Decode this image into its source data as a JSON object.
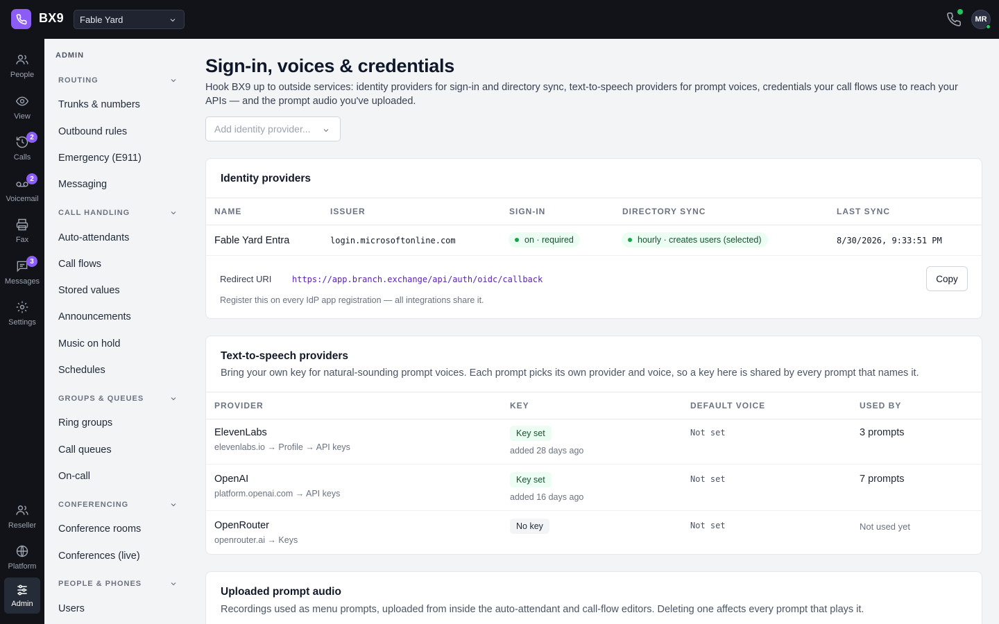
{
  "brand": {
    "name": "BX9",
    "org": "Fable Yard"
  },
  "user": {
    "initials": "MR"
  },
  "rail": {
    "people": "People",
    "view": "View",
    "calls": "Calls",
    "calls_badge": "2",
    "voicemail": "Voicemail",
    "voicemail_badge": "2",
    "fax": "Fax",
    "messages": "Messages",
    "messages_badge": "3",
    "settings": "Settings",
    "reseller": "Reseller",
    "platform": "Platform",
    "admin": "Admin"
  },
  "subnav": {
    "title": "ADMIN",
    "groups": {
      "routing": "ROUTING",
      "call_handling": "CALL HANDLING",
      "groups_queues": "GROUPS & QUEUES",
      "conferencing": "CONFERENCING",
      "people_phones": "PEOPLE & PHONES"
    },
    "links": {
      "trunks": "Trunks & numbers",
      "outbound": "Outbound rules",
      "emergency": "Emergency (E911)",
      "messaging": "Messaging",
      "auto_attendants": "Auto-attendants",
      "call_flows": "Call flows",
      "stored_values": "Stored values",
      "announcements": "Announcements",
      "moh": "Music on hold",
      "schedules": "Schedules",
      "ring_groups": "Ring groups",
      "call_queues": "Call queues",
      "on_call": "On-call",
      "conference_rooms": "Conference rooms",
      "conferences_live": "Conferences (live)",
      "users": "Users"
    }
  },
  "page": {
    "title": "Sign-in, voices & credentials",
    "description": "Hook BX9 up to outside services: identity providers for sign-in and directory sync, text-to-speech providers for prompt voices, credentials your call flows use to reach your APIs — and the prompt audio you've uploaded.",
    "add_idp_placeholder": "Add identity provider..."
  },
  "idp": {
    "title": "Identity providers",
    "headers": {
      "name": "NAME",
      "issuer": "ISSUER",
      "signin": "SIGN-IN",
      "dirsync": "DIRECTORY SYNC",
      "lastsync": "LAST SYNC"
    },
    "row": {
      "name": "Fable Yard Entra",
      "issuer": "login.microsoftonline.com",
      "signin": "on · required",
      "dirsync": "hourly · creates users (selected)",
      "lastsync": "8/30/2026, 9:33:51 PM"
    },
    "redirect_label": "Redirect URI",
    "redirect_uri": "https://app.branch.exchange/api/auth/oidc/callback",
    "copy": "Copy",
    "register_note": "Register this on every IdP app registration — all integrations share it."
  },
  "tts": {
    "title": "Text-to-speech providers",
    "description": "Bring your own key for natural-sounding prompt voices. Each prompt picks its own provider and voice, so a key here is shared by every prompt that names it.",
    "headers": {
      "provider": "PROVIDER",
      "key": "KEY",
      "voice": "DEFAULT VOICE",
      "used": "USED BY"
    },
    "rows": [
      {
        "name": "ElevenLabs",
        "path": "elevenlabs.io → Profile → API keys",
        "key": "Key set",
        "added": "added 28 days ago",
        "voice": "Not set",
        "used": "3 prompts"
      },
      {
        "name": "OpenAI",
        "path": "platform.openai.com → API keys",
        "key": "Key set",
        "added": "added 16 days ago",
        "voice": "Not set",
        "used": "7 prompts"
      },
      {
        "name": "OpenRouter",
        "path": "openrouter.ai → Keys",
        "key": "No key",
        "added": "",
        "voice": "Not set",
        "used": "Not used yet"
      }
    ]
  },
  "audio": {
    "title": "Uploaded prompt audio",
    "description": "Recordings used as menu prompts, uploaded from inside the auto-attendant and call-flow editors. Deleting one affects every prompt that plays it."
  },
  "colors": {
    "accent": "#8b5cf6",
    "chrome": "#111318",
    "success": "#16a34a"
  }
}
